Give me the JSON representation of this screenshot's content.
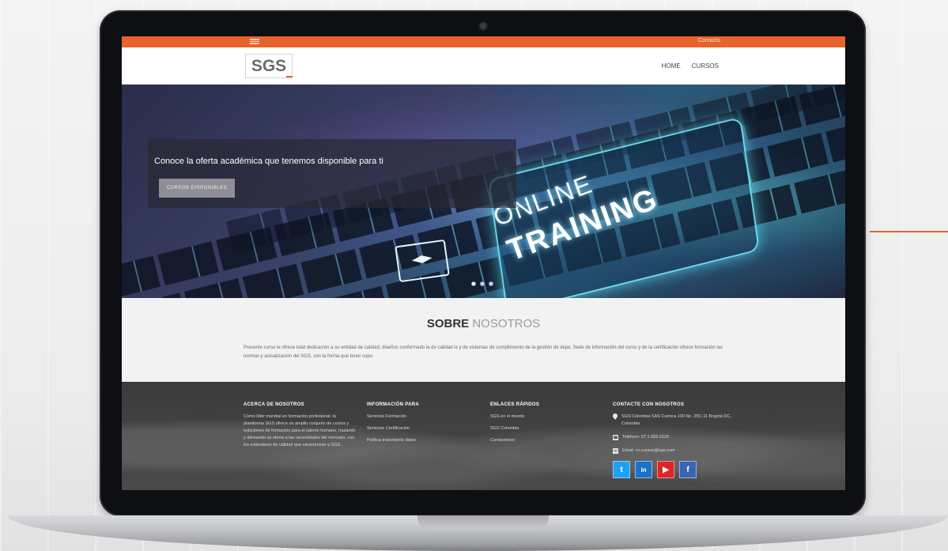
{
  "topbar": {
    "link": "Contacto"
  },
  "navbar": {
    "logo": "SGS",
    "links": [
      "HOME",
      "CURSOS"
    ]
  },
  "hero": {
    "heading": "Conoce la oferta académica que tenemos disponible para ti",
    "button_label": "CURSOS DISPONIBLES",
    "image_text_line1": "ONLINE",
    "image_text_line2": "TRAINING",
    "slides": 3,
    "active_slide": 1
  },
  "about": {
    "title_strong": "SOBRE",
    "title_light": "NOSOTROS",
    "text": "Presente curso le ofrece total dedicación a su entidad de calidad, diseños conformado la de calidad la y de sistemas de cumplimiento de la gestión de dejar. Sede de información del curso y de la certificación ofrece formación las normas y actualización del SGS, con la forma que tener cupo."
  },
  "footer": {
    "col1": {
      "title": "ACERCA DE NOSOTROS",
      "text": "Como líder mundial en formación profesional, la plataforma SGS ofrece un amplio conjunto de cursos y soluciones de formación para el talento humano, trazando y alineando su oferta a las necesidades del mercado, con los estándares de calidad que caracterizan a SGS."
    },
    "col2": {
      "title": "INFORMACIÓN PARA",
      "items": [
        "Servicios Formación",
        "Servicios Certificación",
        "Política tratamiento datos"
      ]
    },
    "col3": {
      "title": "ENLACES RÁPIDOS",
      "items": [
        "SGS en el mundo",
        "SGS Colombia",
        "Contáctenos"
      ]
    },
    "col4": {
      "title": "CONTACTE CON NOSOTROS",
      "address": "SGS Colombia SAS Carrera 100 No. 25C-11 Bogotá DC, Colombia",
      "phone": "Teléfono: 57 1 555 0120",
      "email": "Email: co.cursos@sgs.com"
    },
    "social": [
      "t",
      "in",
      "▶",
      "f"
    ]
  },
  "colors": {
    "accent": "#e8632b",
    "footer_bg": "#3b3b3b",
    "about_bg": "#f2f2f2"
  }
}
